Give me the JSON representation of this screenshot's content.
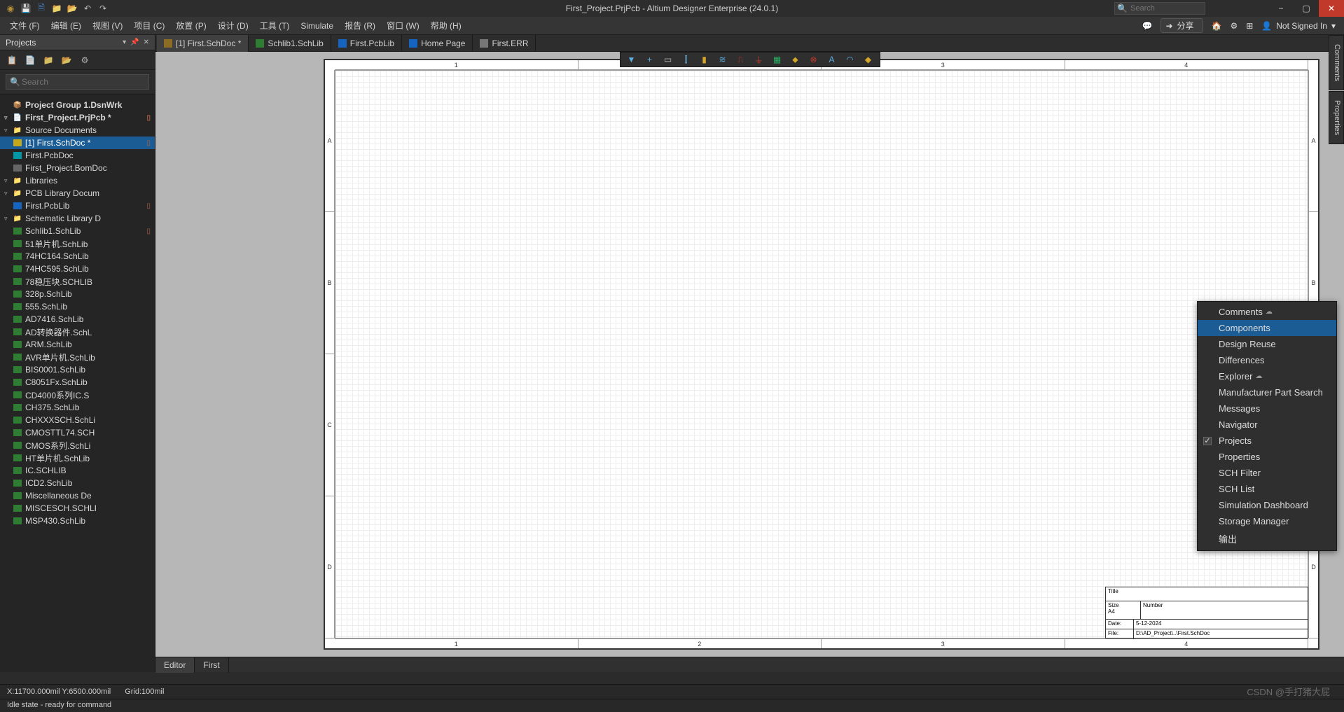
{
  "title": "First_Project.PrjPcb - Altium Designer Enterprise (24.0.1)",
  "search_placeholder": "Search",
  "menus": [
    "文件 (F)",
    "编辑 (E)",
    "视图 (V)",
    "项目 (C)",
    "放置 (P)",
    "设计 (D)",
    "工具 (T)",
    "Simulate",
    "报告 (R)",
    "窗口 (W)",
    "帮助 (H)"
  ],
  "share": "分享",
  "signin": "Not Signed In",
  "projects_title": "Projects",
  "projects_search": "Search",
  "tree": [
    {
      "lvl": 0,
      "tw": "",
      "ic": "📦",
      "txt": "Project Group 1.DsnWrk",
      "bold": true
    },
    {
      "lvl": 1,
      "tw": "▿",
      "ic": "📄",
      "txt": "First_Project.PrjPcb *",
      "bold": true,
      "badge": "▯"
    },
    {
      "lvl": 2,
      "tw": "▿",
      "ic": "📁",
      "txt": "Source Documents"
    },
    {
      "lvl": 3,
      "tw": "",
      "ic": "▢",
      "txt": "[1] First.SchDoc *",
      "sel": true,
      "badge": "▯",
      "icClass": "yellow"
    },
    {
      "lvl": 3,
      "tw": "",
      "ic": "▢",
      "txt": "First.PcbDoc",
      "icClass": "teal"
    },
    {
      "lvl": 3,
      "tw": "",
      "ic": "▢",
      "txt": "First_Project.BomDoc",
      "icClass": "gray"
    },
    {
      "lvl": 2,
      "tw": "▿",
      "ic": "📁",
      "txt": "Libraries"
    },
    {
      "lvl": 3,
      "tw": "▿",
      "ic": "📁",
      "txt": "PCB Library Docum"
    },
    {
      "lvl": 4,
      "tw": "",
      "ic": "▢",
      "txt": "First.PcbLib",
      "badge": "▯",
      "icClass": "blue"
    },
    {
      "lvl": 3,
      "tw": "▿",
      "ic": "📁",
      "txt": "Schematic Library D"
    },
    {
      "lvl": 4,
      "tw": "",
      "ic": "▢",
      "txt": "Schlib1.SchLib",
      "badge": "▯",
      "icClass": "green"
    },
    {
      "lvl": 4,
      "tw": "",
      "ic": "▢",
      "txt": "51单片机.SchLib",
      "icClass": "green"
    },
    {
      "lvl": 4,
      "tw": "",
      "ic": "▢",
      "txt": "74HC164.SchLib",
      "icClass": "green"
    },
    {
      "lvl": 4,
      "tw": "",
      "ic": "▢",
      "txt": "74HC595.SchLib",
      "icClass": "green"
    },
    {
      "lvl": 4,
      "tw": "",
      "ic": "▢",
      "txt": "78稳压块.SCHLIB",
      "icClass": "green"
    },
    {
      "lvl": 4,
      "tw": "",
      "ic": "▢",
      "txt": "328p.SchLib",
      "icClass": "green"
    },
    {
      "lvl": 4,
      "tw": "",
      "ic": "▢",
      "txt": "555.SchLib",
      "icClass": "green"
    },
    {
      "lvl": 4,
      "tw": "",
      "ic": "▢",
      "txt": "AD7416.SchLib",
      "icClass": "green"
    },
    {
      "lvl": 4,
      "tw": "",
      "ic": "▢",
      "txt": "AD转换器件.SchL",
      "icClass": "green"
    },
    {
      "lvl": 4,
      "tw": "",
      "ic": "▢",
      "txt": "ARM.SchLib",
      "icClass": "green"
    },
    {
      "lvl": 4,
      "tw": "",
      "ic": "▢",
      "txt": "AVR单片机.SchLib",
      "icClass": "green"
    },
    {
      "lvl": 4,
      "tw": "",
      "ic": "▢",
      "txt": "BIS0001.SchLib",
      "icClass": "green"
    },
    {
      "lvl": 4,
      "tw": "",
      "ic": "▢",
      "txt": "C8051Fx.SchLib",
      "icClass": "green"
    },
    {
      "lvl": 4,
      "tw": "",
      "ic": "▢",
      "txt": "CD4000系列IC.S",
      "icClass": "green"
    },
    {
      "lvl": 4,
      "tw": "",
      "ic": "▢",
      "txt": "CH375.SchLib",
      "icClass": "green"
    },
    {
      "lvl": 4,
      "tw": "",
      "ic": "▢",
      "txt": "CHXXXSCH.SchLi",
      "icClass": "green"
    },
    {
      "lvl": 4,
      "tw": "",
      "ic": "▢",
      "txt": "CMOSTTL74.SCH",
      "icClass": "green"
    },
    {
      "lvl": 4,
      "tw": "",
      "ic": "▢",
      "txt": "CMOS系列.SchLi",
      "icClass": "green"
    },
    {
      "lvl": 4,
      "tw": "",
      "ic": "▢",
      "txt": "HT单片机.SchLib",
      "icClass": "green"
    },
    {
      "lvl": 4,
      "tw": "",
      "ic": "▢",
      "txt": "IC.SCHLIB",
      "icClass": "green"
    },
    {
      "lvl": 4,
      "tw": "",
      "ic": "▢",
      "txt": "ICD2.SchLib",
      "icClass": "green"
    },
    {
      "lvl": 4,
      "tw": "",
      "ic": "▢",
      "txt": "Miscellaneous De",
      "icClass": "green"
    },
    {
      "lvl": 4,
      "tw": "",
      "ic": "▢",
      "txt": "MISCESCH.SCHLI",
      "icClass": "green"
    },
    {
      "lvl": 4,
      "tw": "",
      "ic": "▢",
      "txt": "MSP430.SchLib",
      "icClass": "green"
    }
  ],
  "doctabs": [
    {
      "label": "[1] First.SchDoc *",
      "active": true,
      "cls": ""
    },
    {
      "label": "Schlib1.SchLib",
      "cls": "green"
    },
    {
      "label": "First.PcbLib",
      "cls": "blue"
    },
    {
      "label": "Home Page",
      "cls": "blue"
    },
    {
      "label": "First.ERR",
      "cls": "gray"
    }
  ],
  "ruler_cols": [
    "1",
    "2",
    "3",
    "4"
  ],
  "ruler_rows": [
    "A",
    "B",
    "C",
    "D"
  ],
  "titleblock": {
    "title_lbl": "Title",
    "size_lbl": "Size",
    "size_val": "A4",
    "number_lbl": "Number",
    "date_lbl": "Date:",
    "date_val": "5-12-2024",
    "file_lbl": "File:",
    "file_val": "D:\\AD_Project\\..\\First.SchDoc"
  },
  "bottabs": [
    "Editor",
    "First"
  ],
  "sidetabs": [
    "Comments",
    "Properties"
  ],
  "ctx": [
    {
      "label": "Comments",
      "cloud": true
    },
    {
      "label": "Components",
      "hl": true
    },
    {
      "label": "Design Reuse"
    },
    {
      "label": "Differences"
    },
    {
      "label": "Explorer",
      "cloud": true
    },
    {
      "label": "Manufacturer Part Search"
    },
    {
      "label": "Messages"
    },
    {
      "label": "Navigator"
    },
    {
      "label": "Projects",
      "chk": true
    },
    {
      "label": "Properties"
    },
    {
      "label": "SCH Filter"
    },
    {
      "label": "SCH List"
    },
    {
      "label": "Simulation Dashboard"
    },
    {
      "label": "Storage Manager"
    },
    {
      "label": "输出"
    }
  ],
  "status": {
    "coords": "X:11700.000mil Y:6500.000mil",
    "grid": "Grid:100mil",
    "idle": "Idle state - ready for command"
  },
  "watermark": "CSDN @手打猪大屁"
}
